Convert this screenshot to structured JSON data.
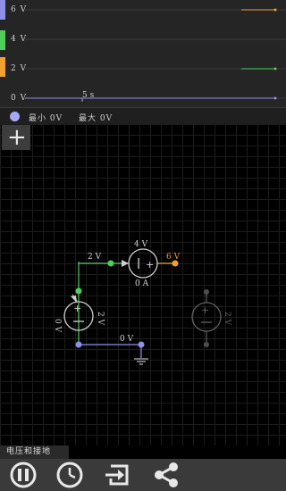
{
  "graph": {
    "y_labels": [
      "6 V",
      "4 V",
      "2 V",
      "0 V"
    ],
    "time_label": "5 s",
    "tab_colors": [
      "#8e8fe8",
      "#4fd05a",
      "#f0a030"
    ],
    "trace_colors": {
      "orange": "#f0a030",
      "green": "#4fd05a",
      "blue": "#8e8fe8"
    }
  },
  "legend": {
    "min": "最小 0V",
    "max": "最大 0V",
    "color": "#a7a8f7"
  },
  "canvas": {
    "add_label": "+",
    "labels": {
      "wire_top_voltage": "2 V",
      "source_voltage": "4 V",
      "source_output": "6 V",
      "source_current": "0 A",
      "battery_left": "0 V",
      "battery_right": "2 V",
      "ground_voltage": "0 V",
      "ghost_battery": "2 V"
    }
  },
  "mode_label": "电压和接地",
  "toolbar": {
    "icons": [
      "pause-icon",
      "clock-icon",
      "export-icon",
      "share-icon"
    ]
  }
}
